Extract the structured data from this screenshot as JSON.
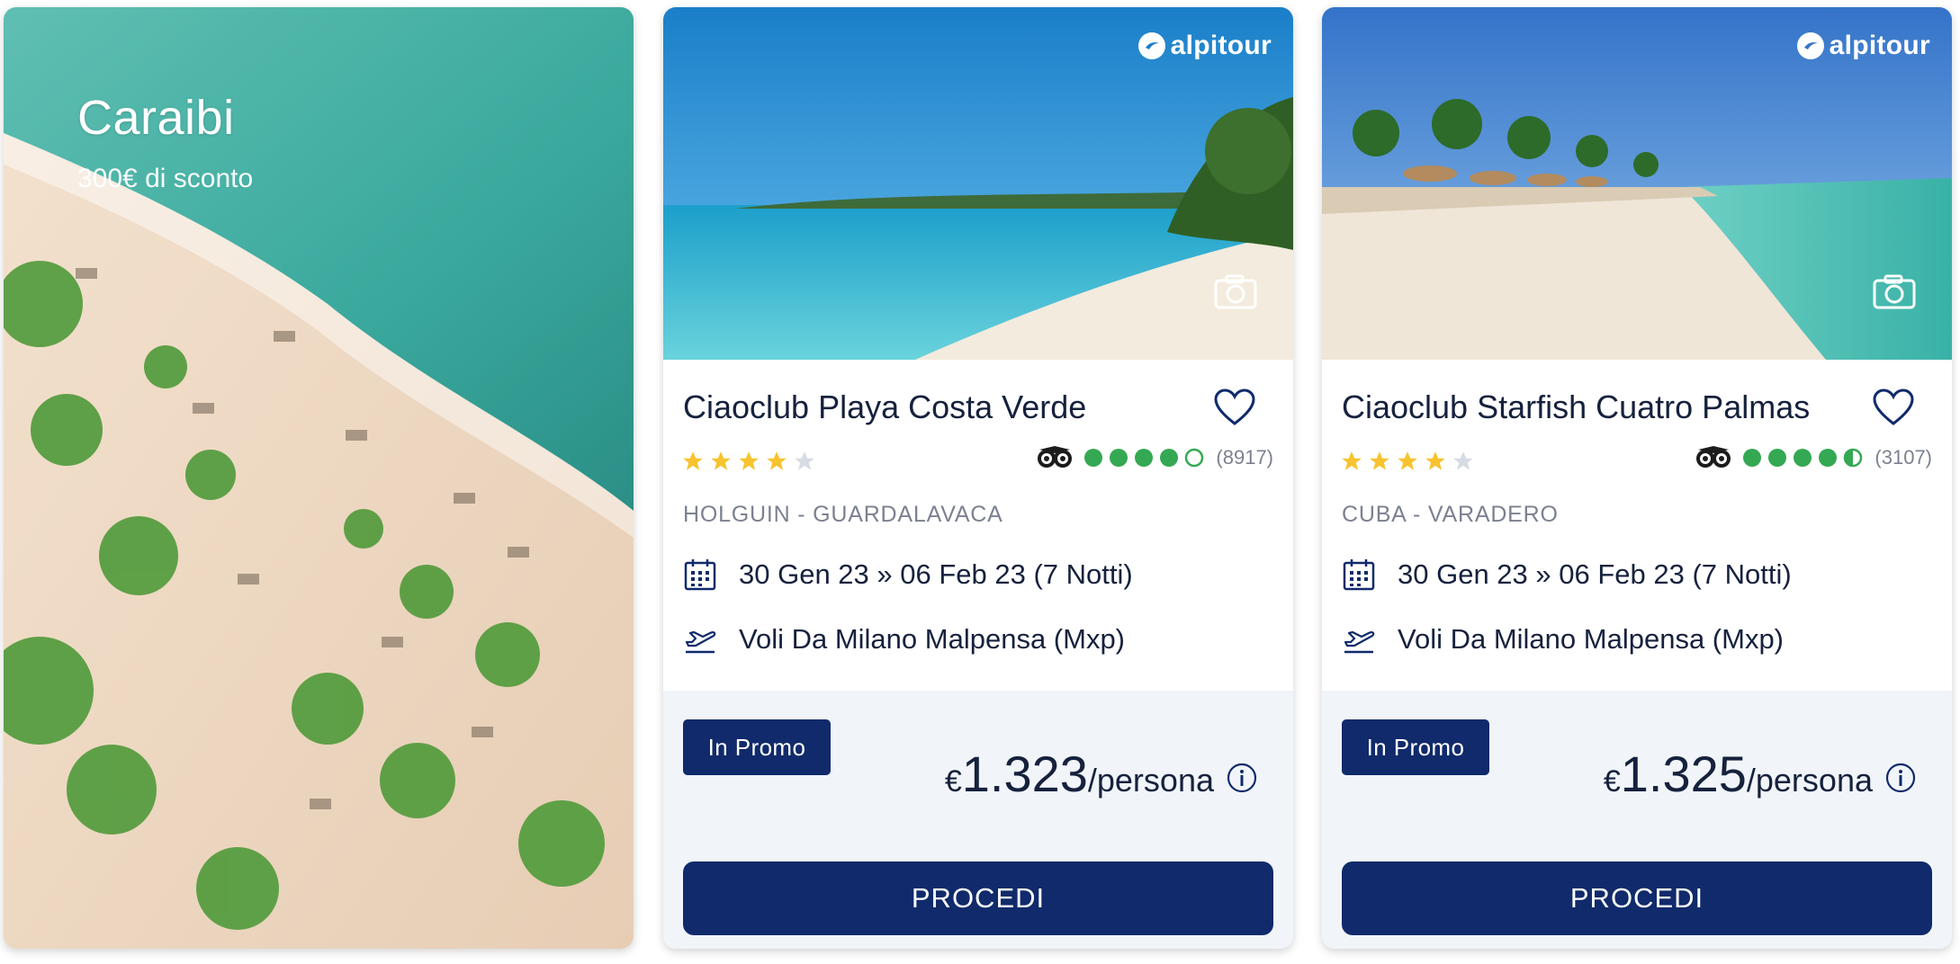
{
  "promo": {
    "title": "Caraibi",
    "subtitle": "300€ di sconto"
  },
  "colors": {
    "navy": "#102a6b",
    "text": "#16213d",
    "muted": "#7b8190",
    "star": "#f7c32e",
    "tripadvisor_green": "#34a853",
    "panel": "#f1f5f9"
  },
  "cards": [
    {
      "brand": "alpitour",
      "name": "Ciaoclub Playa Costa Verde",
      "stars": 4,
      "tripadvisor_rating": 4,
      "reviews": "(8917)",
      "location": "HOLGUIN - GUARDALAVACA",
      "dates": "30 Gen 23 » 06 Feb 23 (7 Notti)",
      "flights": "Voli Da Milano Malpensa (Mxp)",
      "badge": "In Promo",
      "price_currency": "€",
      "price_amount": "1.323",
      "price_unit": "/persona",
      "cta": "PROCEDI"
    },
    {
      "brand": "alpitour",
      "name": "Ciaoclub Starfish Cuatro Palmas",
      "stars": 4,
      "tripadvisor_rating": 4.5,
      "reviews": "(3107)",
      "location": "CUBA - VARADERO",
      "dates": "30 Gen 23 » 06 Feb 23 (7 Notti)",
      "flights": "Voli Da Milano Malpensa (Mxp)",
      "badge": "In Promo",
      "price_currency": "€",
      "price_amount": "1.325",
      "price_unit": "/persona",
      "cta": "PROCEDI"
    }
  ]
}
